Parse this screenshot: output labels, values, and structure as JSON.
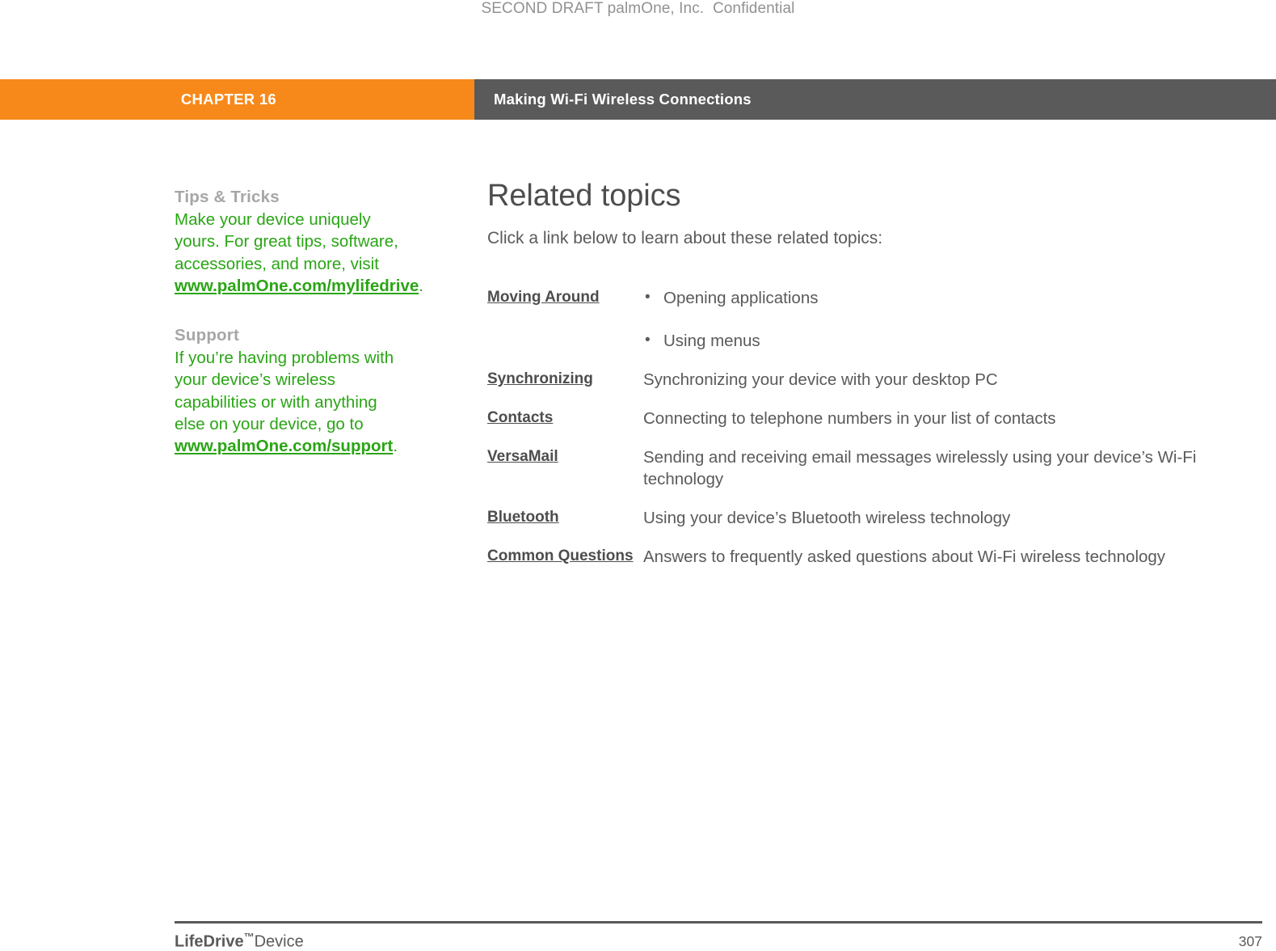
{
  "draft_notice": "SECOND DRAFT palmOne, Inc.  Confidential",
  "header": {
    "chapter_label": "CHAPTER 16",
    "chapter_title": "Making Wi-Fi Wireless Connections",
    "orange_color": "#F7891A",
    "gray_color": "#5A5A5A"
  },
  "sidebar": {
    "accent_color": "#2AA515",
    "heading_color": "#A6A6A6",
    "blocks": [
      {
        "heading": "Tips & Tricks",
        "body": "Make your device uniquely yours. For great tips, software, accessories, and more, visit ",
        "link": "www.palmOne.com/mylifedrive",
        "trailing": "."
      },
      {
        "heading": "Support",
        "body": "If you’re having problems with your device’s wireless capabilities or with anything else on your device, go to ",
        "link": "www.palmOne.com/support",
        "trailing": "."
      }
    ]
  },
  "main": {
    "title": "Related topics",
    "intro": "Click a link below to learn about these related topics:",
    "topics": [
      {
        "link": "Moving Around",
        "bullets": [
          "Opening applications",
          "Using menus"
        ],
        "description": ""
      },
      {
        "link": "Synchronizing",
        "bullets": [],
        "description": "Synchronizing your device with your desktop PC"
      },
      {
        "link": "Contacts",
        "bullets": [],
        "description": "Connecting to telephone numbers in your list of contacts"
      },
      {
        "link": "VersaMail",
        "bullets": [],
        "description": "Sending and receiving email messages wirelessly using your device’s Wi-Fi technology"
      },
      {
        "link": "Bluetooth",
        "bullets": [],
        "description": "Using your device’s Bluetooth wireless technology"
      },
      {
        "link": "Common Questions",
        "bullets": [],
        "description": "Answers to frequently asked questions about Wi-Fi wireless technology"
      }
    ]
  },
  "footer": {
    "brand_bold": "LifeDrive",
    "brand_tm": "™",
    "brand_rest": "Device",
    "page_number": "307"
  }
}
